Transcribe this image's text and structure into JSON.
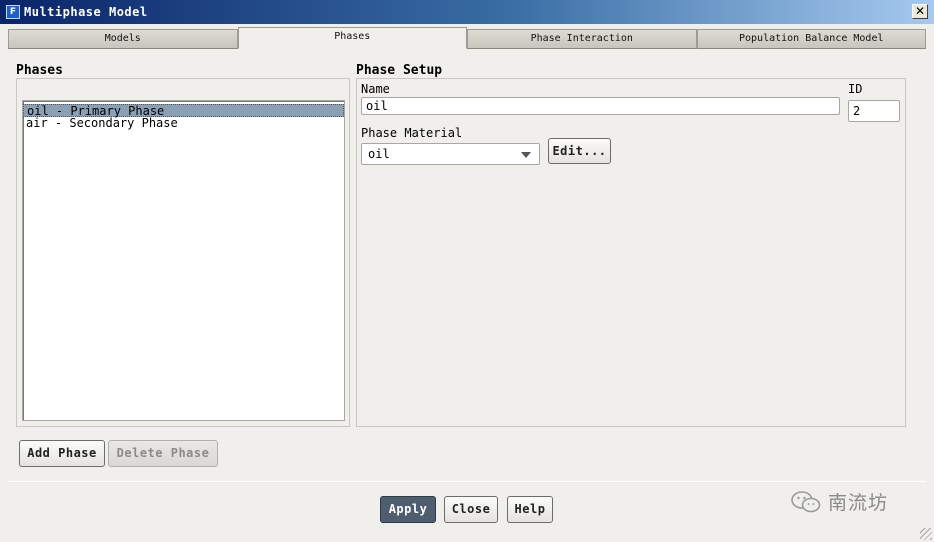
{
  "window": {
    "icon_letter": "F",
    "title": "Multiphase Model",
    "close_label": "✕"
  },
  "tabs": [
    {
      "label": "Models",
      "active": false
    },
    {
      "label": "Phases",
      "active": true
    },
    {
      "label": "Phase Interaction",
      "active": false
    },
    {
      "label": "Population Balance Model",
      "active": false
    }
  ],
  "phases": {
    "title": "Phases",
    "items": [
      {
        "label": "oil - Primary Phase",
        "selected": true
      },
      {
        "label": "air - Secondary Phase",
        "selected": false
      }
    ],
    "add_label": "Add Phase",
    "delete_label": "Delete Phase"
  },
  "phase_setup": {
    "title": "Phase Setup",
    "name_label": "Name",
    "name_value": "oil",
    "id_label": "ID",
    "id_value": "2",
    "material_label": "Phase Material",
    "material_value": "oil",
    "edit_label": "Edit..."
  },
  "footer": {
    "apply_label": "Apply",
    "close_label": "Close",
    "help_label": "Help"
  },
  "watermark": {
    "text": "南流坊",
    "icon": "wechat-icon"
  },
  "colors": {
    "title_start": "#0a246a",
    "title_end": "#a6caf0",
    "selection": "#8b9fb5",
    "apply_bg": "#4e5d70"
  }
}
